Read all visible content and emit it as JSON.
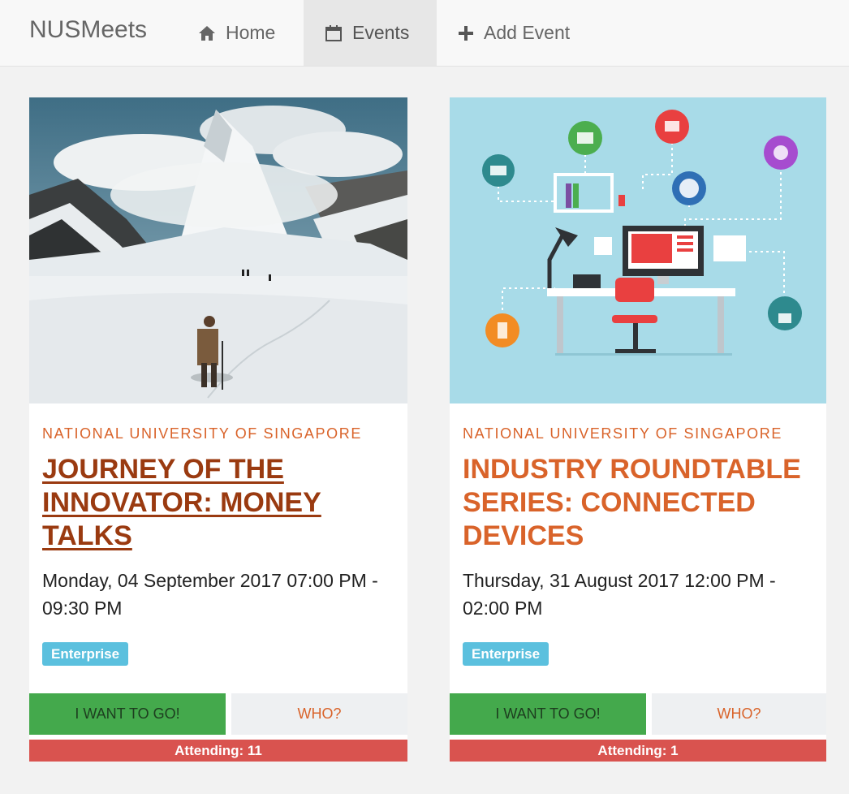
{
  "nav": {
    "brand": "NUSMeets",
    "items": [
      {
        "label": "Home",
        "icon": "home-icon"
      },
      {
        "label": "Events",
        "icon": "calendar-icon",
        "active": true
      },
      {
        "label": "Add Event",
        "icon": "plus-icon"
      }
    ]
  },
  "events": [
    {
      "organizer": "NATIONAL UNIVERSITY OF SINGAPORE",
      "title": "JOURNEY OF THE INNOVATOR: MONEY TALKS",
      "datetime": "Monday, 04 September 2017 07:00 PM - 09:30 PM",
      "tag": "Enterprise",
      "go_label": "I WANT TO GO!",
      "who_label": "WHO?",
      "attending": "Attending: 11",
      "image": "mountain-trekker-photo"
    },
    {
      "organizer": "NATIONAL UNIVERSITY OF SINGAPORE",
      "title": "INDUSTRY ROUNDTABLE SERIES: CONNECTED DEVICES",
      "datetime": "Thursday, 31 August 2017 12:00 PM - 02:00 PM",
      "tag": "Enterprise",
      "go_label": "I WANT TO GO!",
      "who_label": "WHO?",
      "attending": "Attending: 1",
      "image": "connected-devices-illustration"
    }
  ],
  "colors": {
    "accent": "#d9632a",
    "go_button": "#44a94c",
    "attending_bar": "#d9534f",
    "tag": "#5bc0de"
  }
}
